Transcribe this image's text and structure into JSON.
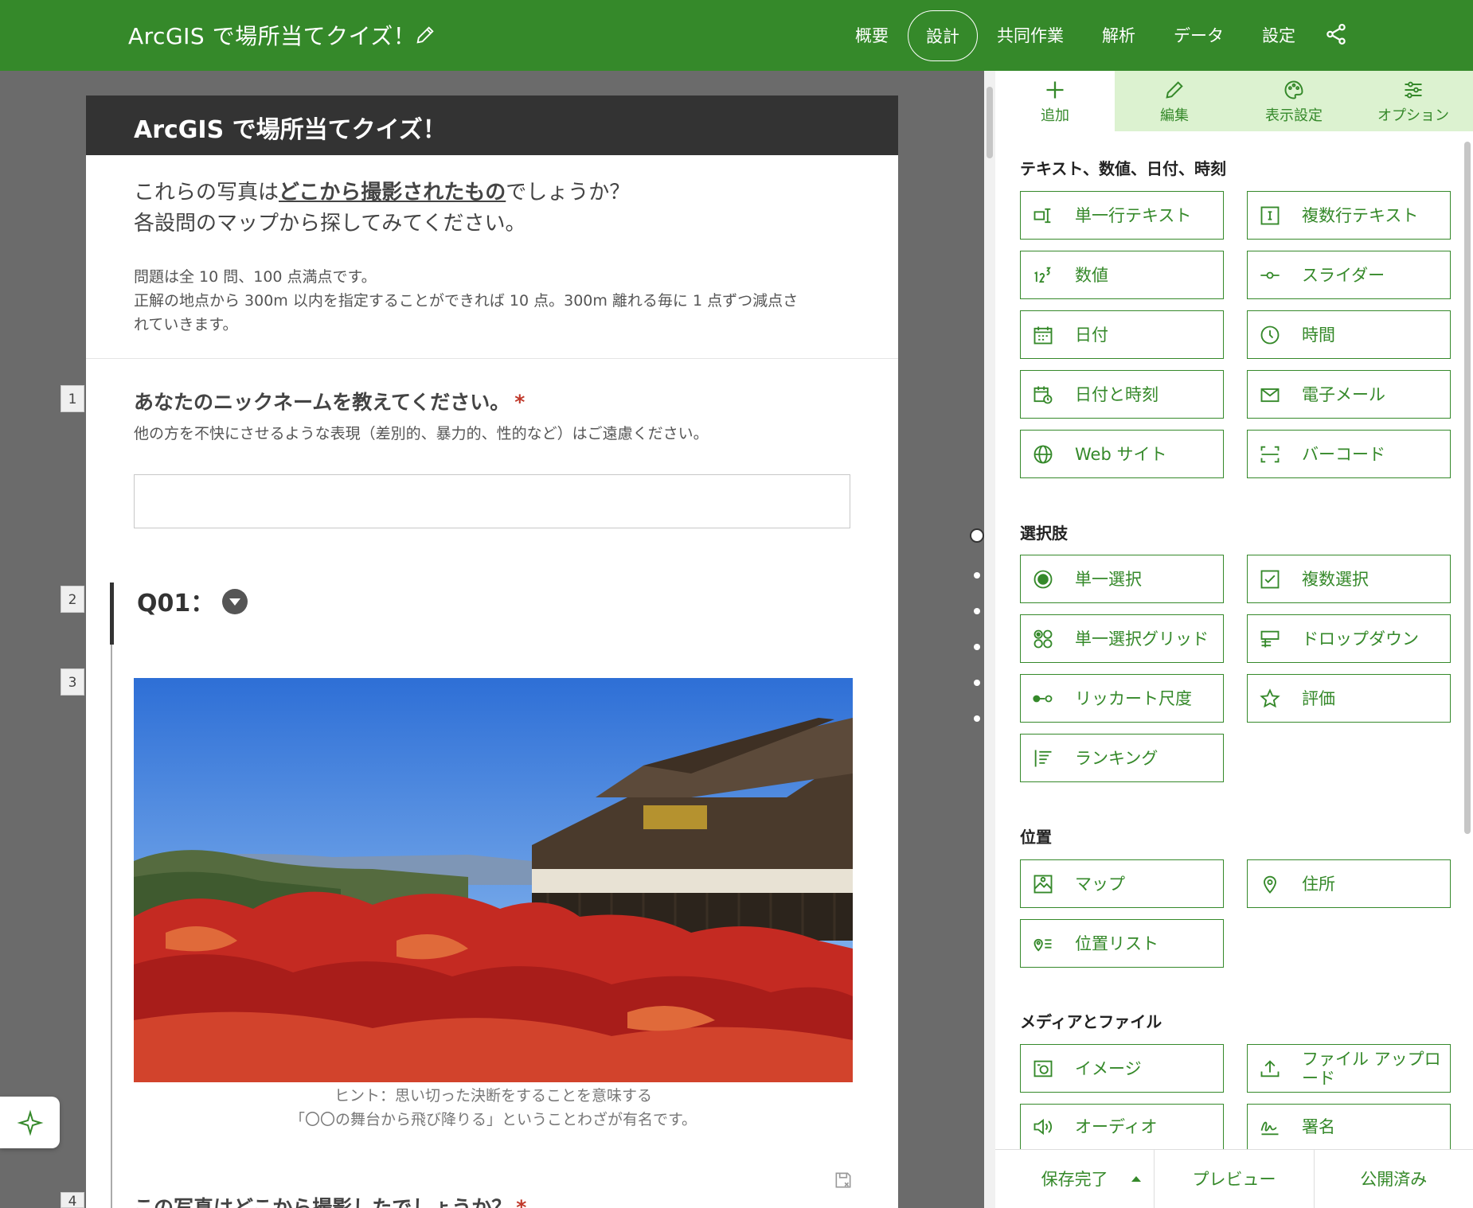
{
  "header": {
    "title": "ArcGIS で場所当てクイズ！",
    "nav": [
      {
        "label": "概要",
        "active": false
      },
      {
        "label": "設計",
        "active": true
      },
      {
        "label": "共同作業",
        "active": false
      },
      {
        "label": "解析",
        "active": false
      },
      {
        "label": "データ",
        "active": false
      },
      {
        "label": "設定",
        "active": false
      }
    ],
    "accent_color": "#35892a"
  },
  "form": {
    "header_title": "ArcGIS で場所当てクイズ！",
    "intro_lead_1": "これらの写真は",
    "intro_lead_bold": "どこから撮影されたもの",
    "intro_lead_2": "でしょうか？",
    "intro_lead_line2": "各設問のマップから探してみてください。",
    "intro_body_1": "問題は全 10 問、100 点満点です。",
    "intro_body_2": "正解の地点から 300m 以内を指定することができれば 10 点。300m 離れる毎に 1 点ずつ減点さ",
    "intro_body_3": "れていきます。",
    "q1_number": "1",
    "q1_title": "あなたのニックネームを教えてください。",
    "q1_required": "*",
    "q1_desc": "他の方を不快にさせるような表現（差別的、暴力的、性的など）はご遠慮ください。",
    "q1_value": "",
    "q2_number": "2",
    "section_title": "Q01：",
    "q3_number": "3",
    "hint_1": "ヒント：思い切った決断をすることを意味する",
    "hint_2": "「〇〇の舞台から飛び降りる」ということわざが有名です。",
    "q4_number": "4",
    "q4_title": "この写真はどこから撮影したでしょうか？",
    "q4_required": "*"
  },
  "panel": {
    "tabs": [
      {
        "label": "追加",
        "icon": "plus-icon",
        "active": true
      },
      {
        "label": "編集",
        "icon": "pencil-icon",
        "active": false
      },
      {
        "label": "表示設定",
        "icon": "palette-icon",
        "active": false
      },
      {
        "label": "オプション",
        "icon": "sliders-icon",
        "active": false
      }
    ],
    "groups": {
      "text": "テキスト、数値、日付、時刻",
      "choice": "選択肢",
      "location": "位置",
      "media": "メディアとファイル"
    },
    "tools": {
      "single_line": "単一行テキスト",
      "multi_line": "複数行テキスト",
      "number": "数値",
      "slider": "スライダー",
      "date": "日付",
      "time": "時間",
      "datetime": "日付と時刻",
      "email": "電子メール",
      "website": "Web サイト",
      "barcode": "バーコード",
      "single_choice": "単一選択",
      "multi_choice": "複数選択",
      "single_choice_grid": "単一選択グリッド",
      "dropdown": "ドロップダウン",
      "likert": "リッカート尺度",
      "rating": "評価",
      "ranking": "ランキング",
      "map": "マップ",
      "address": "住所",
      "location_list": "位置リスト",
      "image": "イメージ",
      "file_upload": "ファイル アップロード",
      "audio": "オーディオ",
      "signature": "署名"
    }
  },
  "footer": {
    "save": "保存完了",
    "preview": "プレビュー",
    "publish": "公開済み"
  }
}
